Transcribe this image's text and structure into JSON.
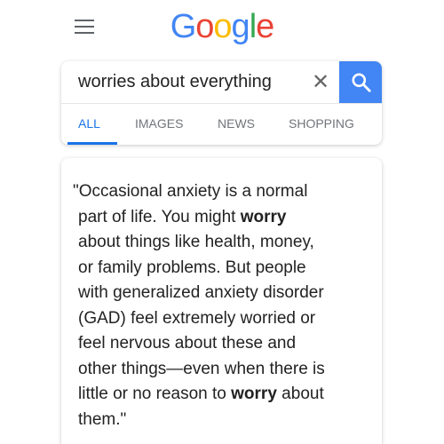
{
  "logo": {
    "letters": [
      {
        "char": "G",
        "color": "#4285f4"
      },
      {
        "char": "o",
        "color": "#ea4335"
      },
      {
        "char": "o",
        "color": "#fbbc05"
      },
      {
        "char": "g",
        "color": "#4285f4"
      },
      {
        "char": "l",
        "color": "#34a853"
      },
      {
        "char": "e",
        "color": "#ea4335"
      }
    ]
  },
  "header": {
    "menu_icon": "hamburger-menu-icon"
  },
  "search": {
    "query": "worries about everything",
    "clear_label": "✕",
    "search_icon": "magnifier-icon",
    "accent_color": "#4285f4"
  },
  "tabs": [
    {
      "label": "ALL",
      "active": true
    },
    {
      "label": "IMAGES",
      "active": false
    },
    {
      "label": "NEWS",
      "active": false
    },
    {
      "label": "SHOPPING",
      "active": false
    }
  ],
  "result": {
    "lines": [
      [
        {
          "t": "\"Occasional anxiety is a normal"
        }
      ],
      [
        {
          "t": "part of life. You might "
        },
        {
          "t": "worry",
          "b": true
        }
      ],
      [
        {
          "t": "about things like health, money,"
        }
      ],
      [
        {
          "t": "or family problems. But people"
        }
      ],
      [
        {
          "t": "with generalized anxiety disorder"
        }
      ],
      [
        {
          "t": "(GAD) feel extremely worried or"
        }
      ],
      [
        {
          "t": "feel nervous about these and"
        }
      ],
      [
        {
          "t": "other things—even when there is"
        }
      ],
      [
        {
          "t": "little or no reason to "
        },
        {
          "t": "worry",
          "b": true
        },
        {
          "t": " about"
        }
      ],
      [
        {
          "t": "them.\""
        }
      ]
    ]
  }
}
